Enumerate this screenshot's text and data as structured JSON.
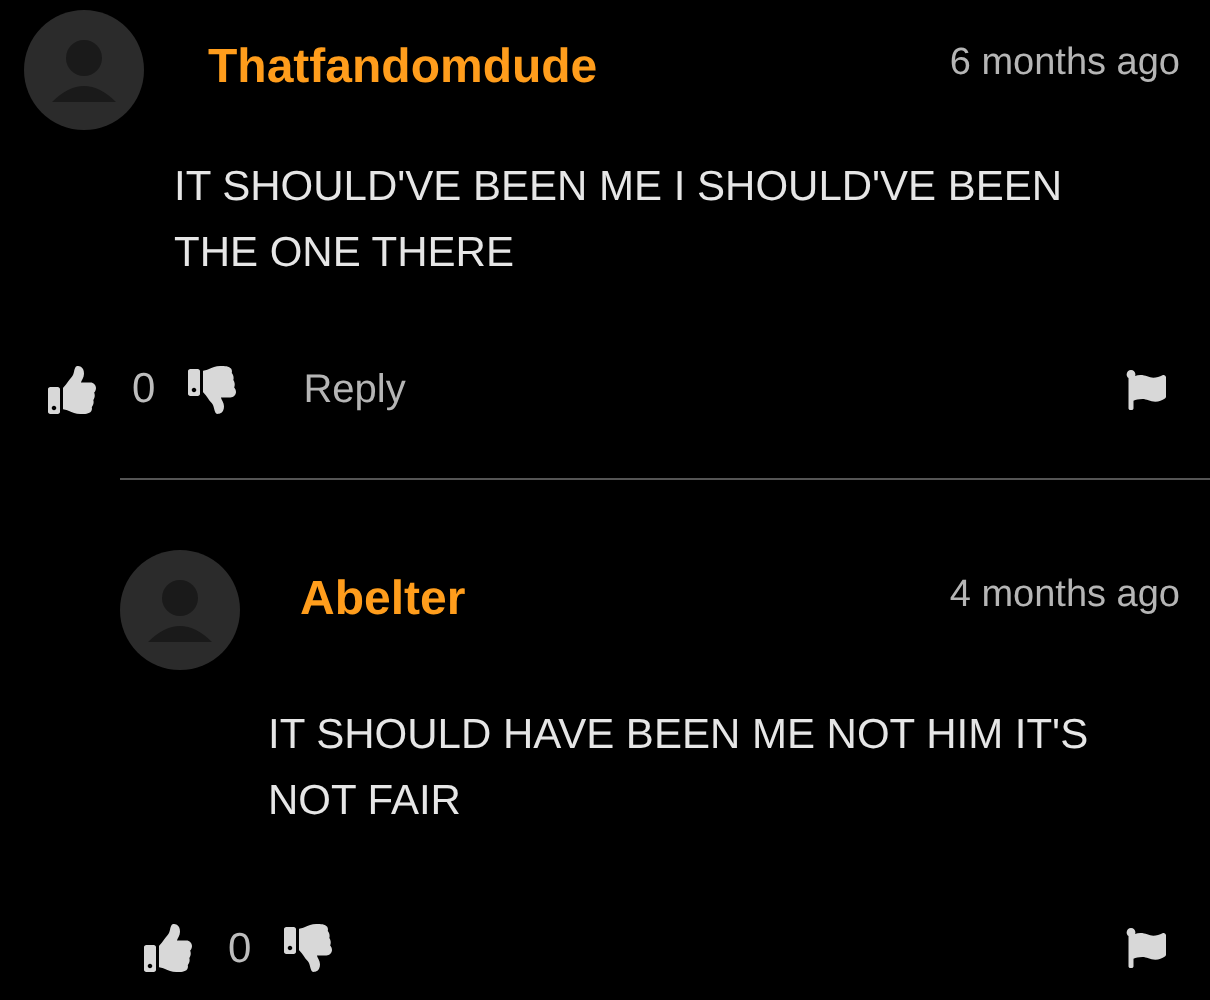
{
  "comments": [
    {
      "author": "Thatfandomdude",
      "time": "6 months ago",
      "text": "IT SHOULD'VE BEEN ME I SHOULD'VE BEEN THE ONE THERE",
      "score": "0",
      "reply_label": "Reply",
      "children": [
        {
          "author": "Abelter",
          "time": "4 months ago",
          "text": "IT SHOULD HAVE BEEN ME NOT HIM IT'S NOT FAIR",
          "score": "0"
        }
      ]
    }
  ]
}
